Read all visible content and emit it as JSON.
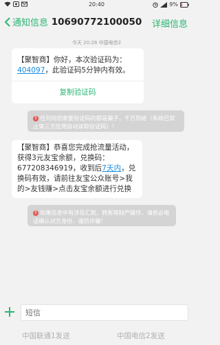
{
  "status_bar": {
    "time": "20:40",
    "battery": "9%"
  },
  "nav": {
    "back_label": "通知信息",
    "title": "10690772100050",
    "detail_label": "详细信息"
  },
  "message_time": "今天 20:28  中国电信2",
  "messages": [
    {
      "text_before_code": "【聚智商】你好，本次验证码为：",
      "code": "404097",
      "text_after_code": "，此验证码5分钟内有效。",
      "copy_label": "复制验证码"
    },
    {
      "text_before_link": "【聚智商】恭喜您完成抢流量活动，获得3元友宝余额，兑换码：677208346919，收到后",
      "link": "7天内",
      "text_after_link": "，兑换码有效，请前往友宝公众账号>我的>友钱赚>点击友宝余额进行兑换"
    }
  ],
  "warnings": [
    "任何向您索要验证码的都是骗子，千万别给（系统已禁止第三方应用自动读取验证码）！",
    "如果信息中有涉及汇款、转账等财产操作，请务必电话确认对方身份，谨防诈骗！"
  ],
  "input": {
    "placeholder": "短信"
  },
  "send_buttons": [
    "中国联通1发送",
    "中国电信2发送"
  ],
  "colors": {
    "accent": "#2bb673",
    "link": "#1a8be0",
    "warning_bg": "#d4d4d4"
  }
}
